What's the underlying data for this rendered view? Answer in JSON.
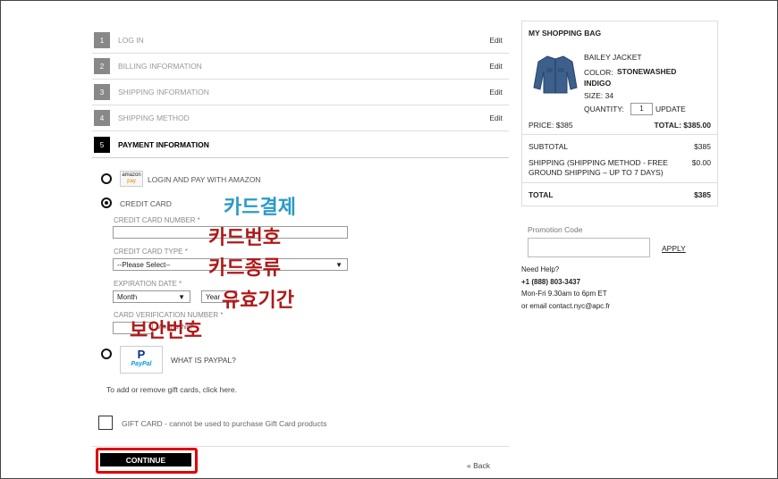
{
  "steps": [
    {
      "num": "1",
      "label": "LOG IN",
      "edit": "Edit"
    },
    {
      "num": "2",
      "label": "BILLING INFORMATION",
      "edit": "Edit"
    },
    {
      "num": "3",
      "label": "SHIPPING INFORMATION",
      "edit": "Edit"
    },
    {
      "num": "4",
      "label": "SHIPPING METHOD",
      "edit": "Edit"
    },
    {
      "num": "5",
      "label": "PAYMENT INFORMATION",
      "edit": ""
    }
  ],
  "amazon": {
    "logo_top": "amazon",
    "logo_bottom": "pay",
    "label": "LOGIN AND PAY WITH AMAZON"
  },
  "credit": {
    "label": "CREDIT CARD",
    "number_label": "CREDIT CARD NUMBER *",
    "type_label": "CREDIT CARD TYPE *",
    "type_value": "--Please Select--",
    "exp_label": "EXPIRATION DATE *",
    "month": "Month",
    "year": "Year",
    "cvn_label": "CARD VERIFICATION NUMBER *",
    "cvn_help": "What is this?"
  },
  "paypal": {
    "logo": "PayPal",
    "label": "WHAT IS PAYPAL?"
  },
  "gift_note": "To add or remove gift cards, click here.",
  "gift_card": "GIFT CARD - cannot be used to purchase Gift Card products",
  "continue": "CONTINUE",
  "back": "« Back",
  "annotations": {
    "payment": "카드결제",
    "number": "카드번호",
    "type": "카드종류",
    "expiry": "유효기간",
    "security": "보안번호"
  },
  "bag": {
    "title": "MY SHOPPING BAG",
    "name": "BAILEY JACKET",
    "color_label": "COLOR:",
    "color_value": "STONEWASHED INDIGO",
    "size": "SIZE: 34",
    "qty_label": "QUANTITY:",
    "qty": "1",
    "update": "UPDATE",
    "price": "PRICE: $385",
    "total_line": "TOTAL: $385.00",
    "subtotal_label": "SUBTOTAL",
    "subtotal": "$385",
    "shipping_label": "SHIPPING (SHIPPING METHOD - FREE GROUND SHIPPING – UP TO 7 DAYS)",
    "shipping": "$0.00",
    "total_label": "TOTAL",
    "total": "$385"
  },
  "promo": {
    "label": "Promotion Code",
    "apply": "APPLY"
  },
  "help": {
    "title": "Need Help?",
    "phone": "+1 (888) 803-3437",
    "hours": "Mon-Fri 9.30am to 6pm ET",
    "email": "or email contact.nyc@apc.fr"
  },
  "colors": {
    "annotation_blue": "#2a9ac8",
    "annotation_red": "#b01818",
    "highlight": "#e00000"
  }
}
